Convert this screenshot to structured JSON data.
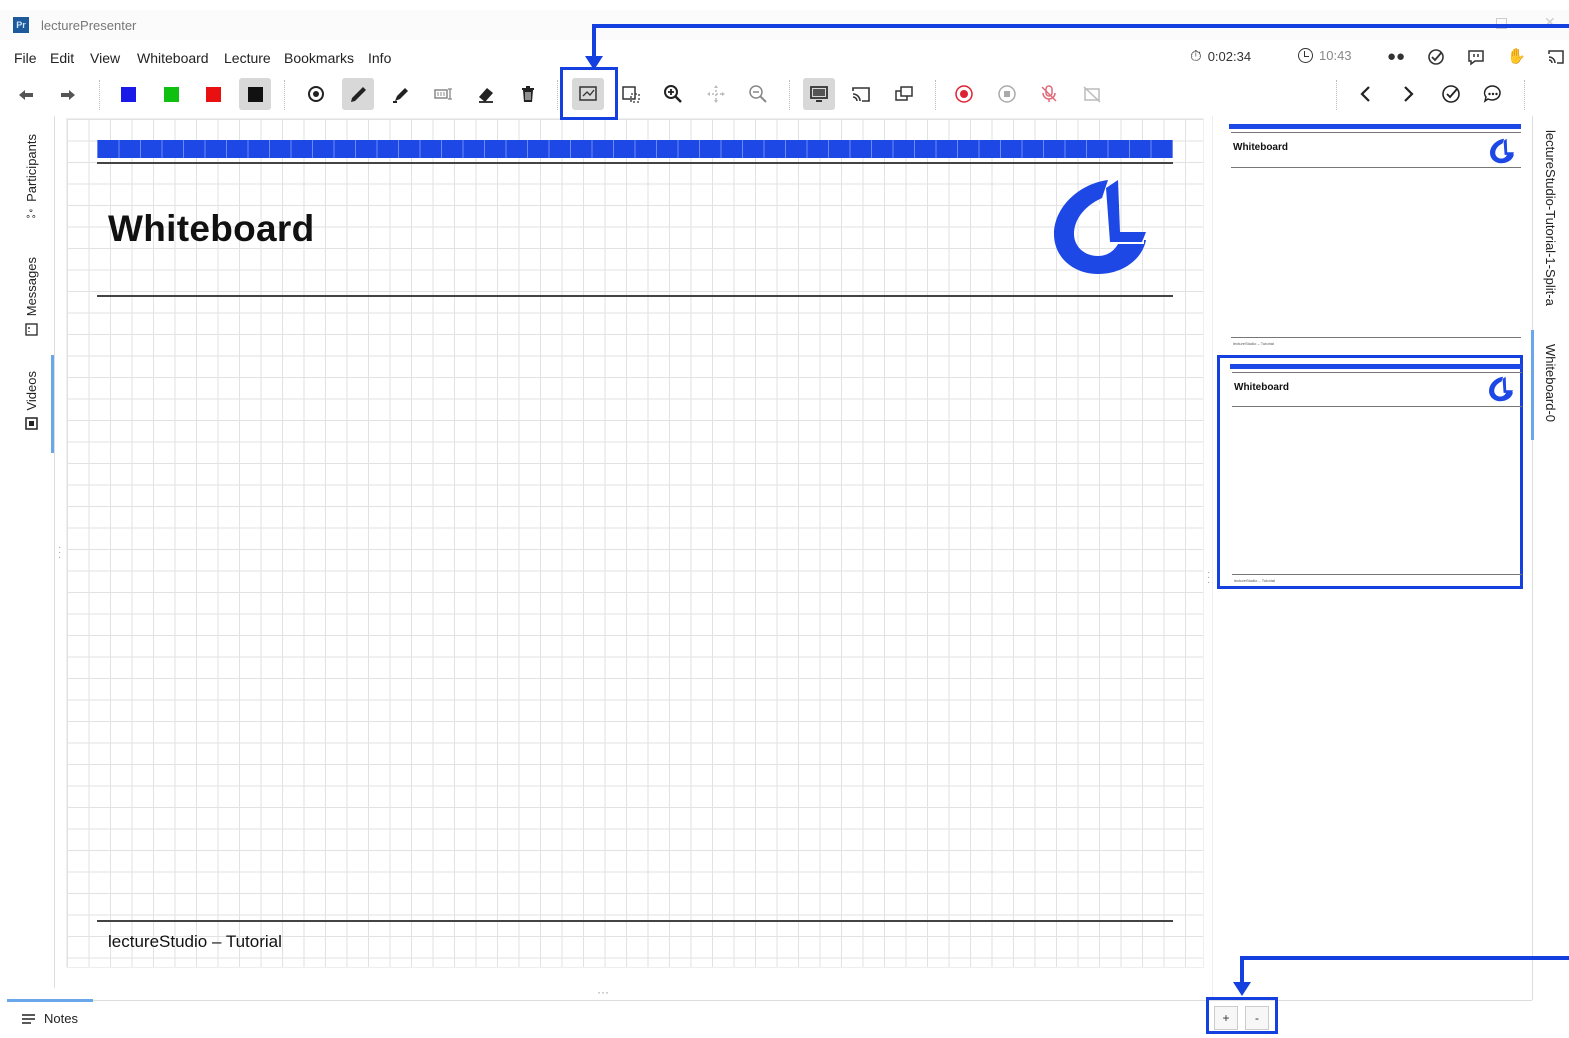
{
  "window": {
    "app_icon_text": "Pr",
    "title": "lecturePresenter"
  },
  "menu": {
    "items": [
      "File",
      "Edit",
      "View",
      "Whiteboard",
      "Lecture",
      "Bookmarks",
      "Info"
    ],
    "stopwatch": "0:02:34",
    "clock": "10:43",
    "status_icons": [
      "glasses-icon",
      "quiz-check-icon",
      "chat-icon",
      "raise-hand-icon",
      "cast-icon"
    ]
  },
  "toolbar": {
    "colors": {
      "blue": "#1a1ae8",
      "green": "#10c010",
      "red": "#e81010",
      "black": "#111111"
    }
  },
  "left_tabs": {
    "participants": "Participants",
    "messages": "Messages",
    "videos": "Videos"
  },
  "slide": {
    "title": "Whiteboard",
    "footer": "lectureStudio – Tutorial",
    "accent_color": "#1e48e6"
  },
  "previews": [
    {
      "title": "Whiteboard",
      "footer": "lectureStudio – Tutorial",
      "selected": false
    },
    {
      "title": "Whiteboard",
      "footer": "lectureStudio – Tutorial",
      "selected": true
    }
  ],
  "right_tabs": {
    "doc1": "lectureStudio-Tutorial-1-Split-a",
    "doc2": "Whiteboard-0"
  },
  "bottom": {
    "notes": "Notes",
    "add_page": "+",
    "remove_page": "-"
  }
}
